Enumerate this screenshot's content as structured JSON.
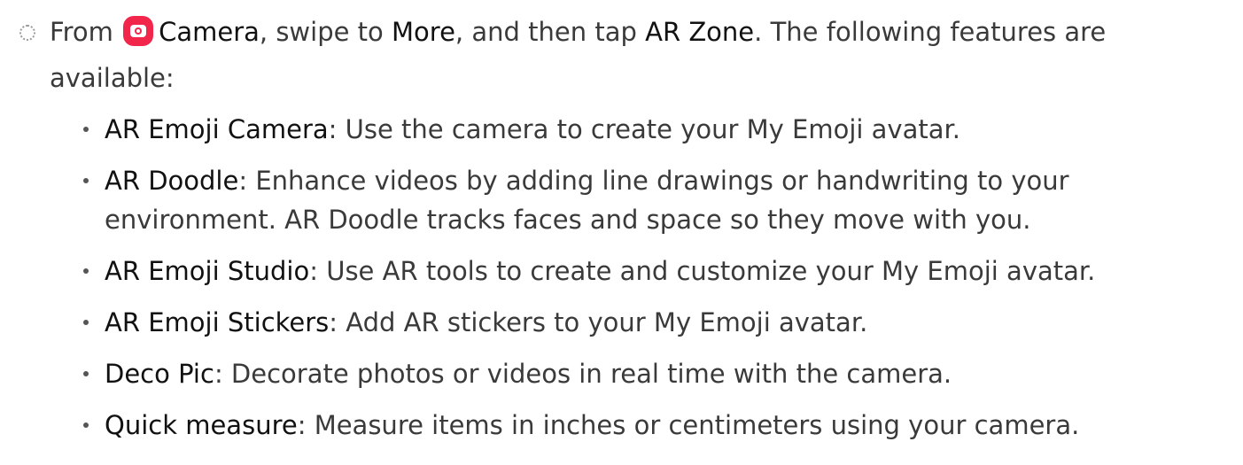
{
  "step": {
    "marker_icon": "dotted-circle-icon",
    "from_text": "From",
    "camera_icon": "camera-app-icon",
    "camera_icon_color": "#f2264b",
    "camera_label": "Camera",
    "swipe_text": ", swipe to",
    "more_label": "More",
    "tap_text": ", and then tap",
    "ar_zone_label": "AR Zone",
    "following_text": ". The following features are available:"
  },
  "features": [
    {
      "name": "AR Emoji Camera",
      "description": ": Use the camera to create your My Emoji avatar."
    },
    {
      "name": "AR Doodle",
      "description": ": Enhance videos by adding line drawings or handwriting to your environment. AR Doodle tracks faces and space so they move with you."
    },
    {
      "name": "AR Emoji Studio",
      "description": ": Use AR tools to create and customize your My Emoji avatar."
    },
    {
      "name": "AR Emoji Stickers",
      "description": ": Add AR stickers to your My Emoji avatar."
    },
    {
      "name": "Deco Pic",
      "description": ": Decorate photos or videos in real time with the camera."
    },
    {
      "name": "Quick measure",
      "description": ": Measure items in inches or centimeters using your camera."
    }
  ]
}
